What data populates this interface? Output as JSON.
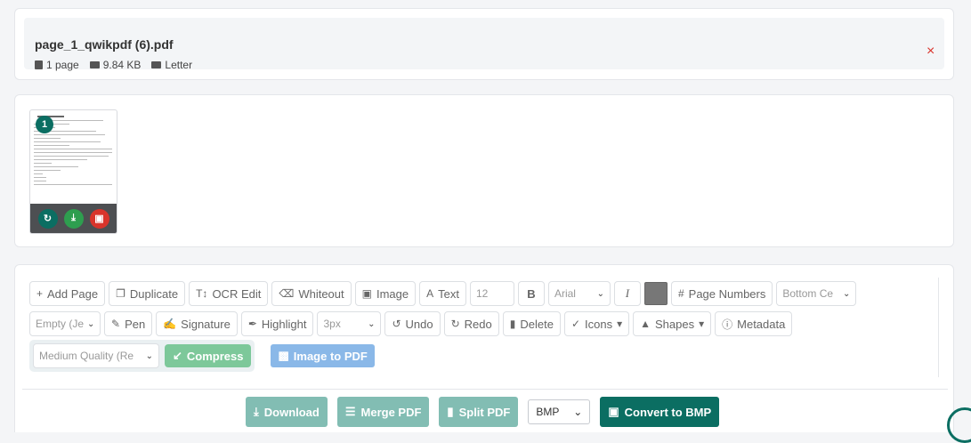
{
  "file": {
    "name": "page_1_qwikpdf (6).pdf",
    "pages": "1 page",
    "size": "9.84 KB",
    "format": "Letter",
    "remove": "×"
  },
  "thumbnail": {
    "page_number": "1",
    "actions": [
      "rotate-icon",
      "download-icon",
      "trash-icon"
    ]
  },
  "toolbar": {
    "add_page": "Add Page",
    "duplicate": "Duplicate",
    "ocr_edit": "OCR Edit",
    "whiteout": "Whiteout",
    "image": "Image",
    "text": "Text",
    "font_size": "12",
    "bold": "B",
    "font": "Arial",
    "italic": "I",
    "page_numbers": "Page Numbers",
    "position": "Bottom Ce",
    "empty_select": "Empty (Je",
    "pen": "Pen",
    "signature": "Signature",
    "highlight": "Highlight",
    "stroke": "3px",
    "undo": "Undo",
    "redo": "Redo",
    "delete": "Delete",
    "icons": "Icons",
    "shapes": "Shapes",
    "metadata": "Metadata",
    "quality": "Medium Quality (Re",
    "compress": "Compress",
    "image_to_pdf": "Image to PDF"
  },
  "actions": {
    "download": "Download",
    "merge_pdf": "Merge PDF",
    "split_pdf": "Split PDF",
    "format": "BMP",
    "convert": "Convert to BMP"
  },
  "colors": {
    "teal": "#0b6e62",
    "teal_light": "#82bdb3",
    "red": "#d9342b",
    "green": "#2e9e4f",
    "swatch": "#777777"
  }
}
